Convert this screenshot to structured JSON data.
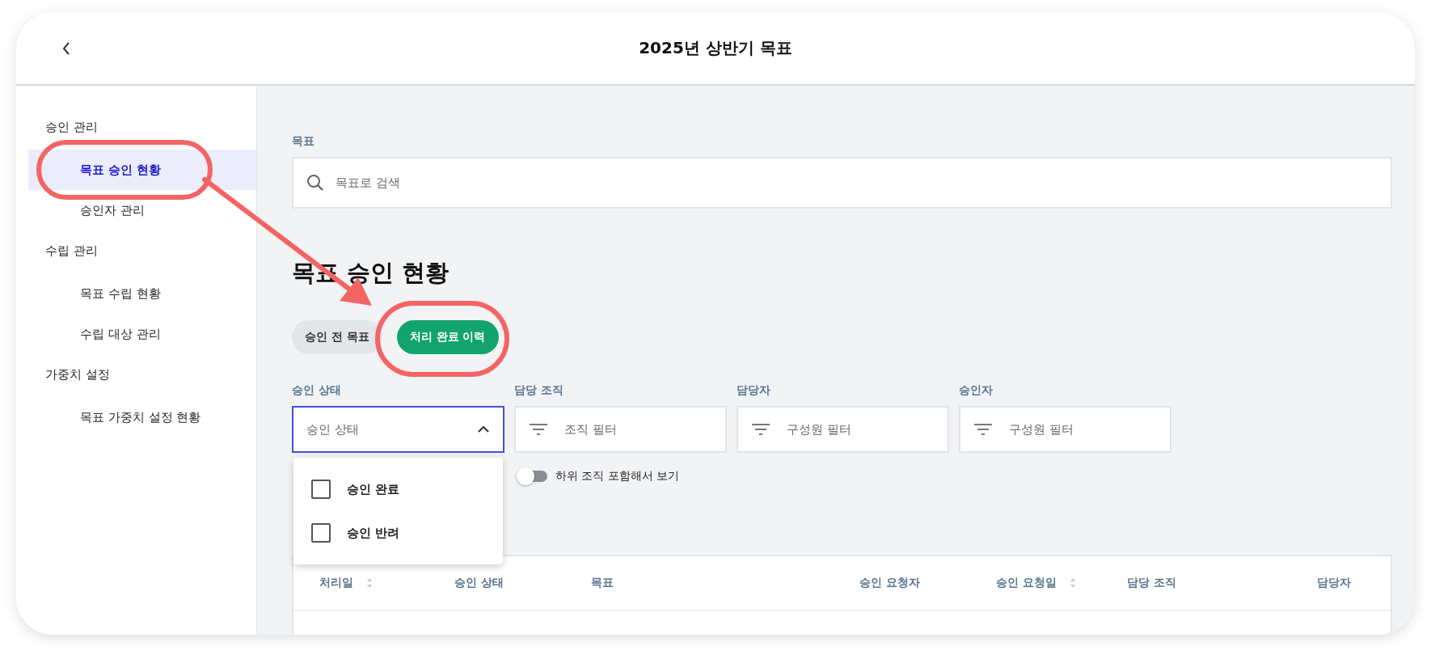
{
  "header": {
    "title": "2025년 상반기 목표"
  },
  "sidebar": {
    "sections": [
      {
        "title": "승인 관리",
        "items": [
          {
            "label": "목표 승인 현황",
            "selected": true
          },
          {
            "label": "승인자 관리",
            "selected": false
          }
        ]
      },
      {
        "title": "수립 관리",
        "items": [
          {
            "label": "목표 수립 현황",
            "selected": false
          },
          {
            "label": "수립 대상 관리",
            "selected": false
          }
        ]
      },
      {
        "title": "가중치 설정",
        "items": [
          {
            "label": "목표 가중치 설정 현황",
            "selected": false
          }
        ]
      }
    ]
  },
  "search": {
    "label": "목표",
    "placeholder": "목표로 검색"
  },
  "page_title": "목표 승인 현황",
  "view_tabs": [
    {
      "label": "승인 전 목표",
      "selected": false
    },
    {
      "label": "처리 완료 이력",
      "selected": true
    }
  ],
  "filters": [
    {
      "label": "승인 상태",
      "placeholder": "승인 상태",
      "kind": "select",
      "expanded": true
    },
    {
      "label": "담당 조직",
      "placeholder": "조직 필터",
      "kind": "filter"
    },
    {
      "label": "담당자",
      "placeholder": "구성원 필터",
      "kind": "filter"
    },
    {
      "label": "승인자",
      "placeholder": "구성원 필터",
      "kind": "filter"
    }
  ],
  "toggle": {
    "label": "하위 조직 포함해서 보기",
    "on": false
  },
  "dropdown_options": [
    {
      "label": "승인 완료",
      "checked": false
    },
    {
      "label": "승인 반려",
      "checked": false
    }
  ],
  "table": {
    "columns": [
      {
        "label": "처리일",
        "sortable": true
      },
      {
        "label": "승인 상태",
        "sortable": false
      },
      {
        "label": "목표",
        "sortable": false
      },
      {
        "label": "승인 요청자",
        "sortable": false
      },
      {
        "label": "승인 요청일",
        "sortable": true
      },
      {
        "label": "담당 조직",
        "sortable": false
      },
      {
        "label": "담당자",
        "sortable": false
      }
    ]
  }
}
